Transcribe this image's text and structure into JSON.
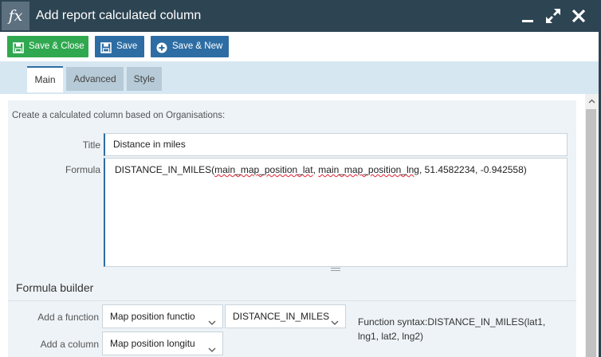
{
  "window": {
    "icon_text": "fx",
    "title": "Add report calculated column",
    "icons": [
      "minimize-icon",
      "maximize-icon",
      "close-icon"
    ]
  },
  "toolbar": {
    "save_close_label": "Save & Close",
    "save_label": "Save",
    "save_new_label": "Save & New",
    "colors": {
      "green": "#2fa84f",
      "blue": "#2d6da3"
    }
  },
  "tabs": [
    {
      "label": "Main",
      "active": true
    },
    {
      "label": "Advanced",
      "active": false
    },
    {
      "label": "Style",
      "active": false
    }
  ],
  "form": {
    "description": "Create a calculated column based on Organisations:",
    "title_label": "Title",
    "title_value": "Distance in miles",
    "formula_label": "Formula",
    "formula": {
      "fn": "DISTANCE_IN_MILES(",
      "arg1": "main_map_position_lat",
      "sep1": ", ",
      "arg2": "main_map_position_lng",
      "rest": ", 51.4582234, -0.942558)"
    }
  },
  "formula_builder": {
    "heading": "Formula builder",
    "add_function_label": "Add a function",
    "function_type_value": "Map position functio",
    "function_value": "DISTANCE_IN_MILES",
    "add_column_label": "Add a column",
    "column_value": "Map position longitu",
    "syntax_text": "Function syntax:DISTANCE_IN_MILES(lat1, lng1, lat2, lng2)"
  }
}
